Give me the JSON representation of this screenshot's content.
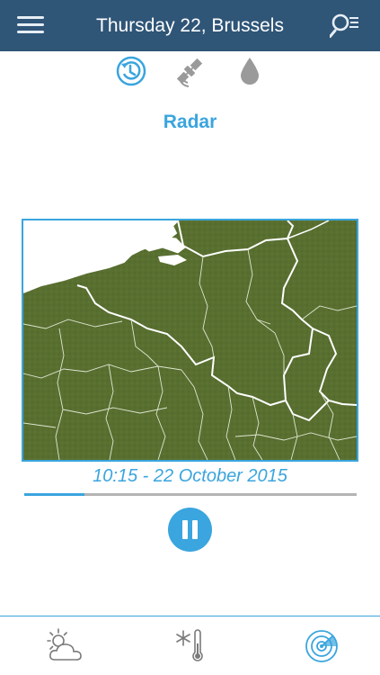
{
  "header": {
    "title": "Thursday 22, Brussels",
    "menu_icon": "hamburger-menu-icon",
    "search_icon": "search-list-icon"
  },
  "mode_tabs": [
    {
      "icon": "history-clock-icon",
      "active": true
    },
    {
      "icon": "satellite-icon",
      "active": false
    },
    {
      "icon": "water-drop-icon",
      "active": false
    }
  ],
  "section": {
    "title": "Radar"
  },
  "radar": {
    "timestamp": "10:15 - 22 October 2015",
    "progress": 0.18
  },
  "bottom_tabs": [
    {
      "icon": "sun-cloud-icon",
      "active": false
    },
    {
      "icon": "snowflake-thermometer-icon",
      "active": false
    },
    {
      "icon": "radar-icon",
      "active": true
    }
  ],
  "colors": {
    "header_bg": "#2f5577",
    "accent": "#3aa5de",
    "inactive_icon": "#9a9a9a",
    "map_land": "#586f30"
  }
}
